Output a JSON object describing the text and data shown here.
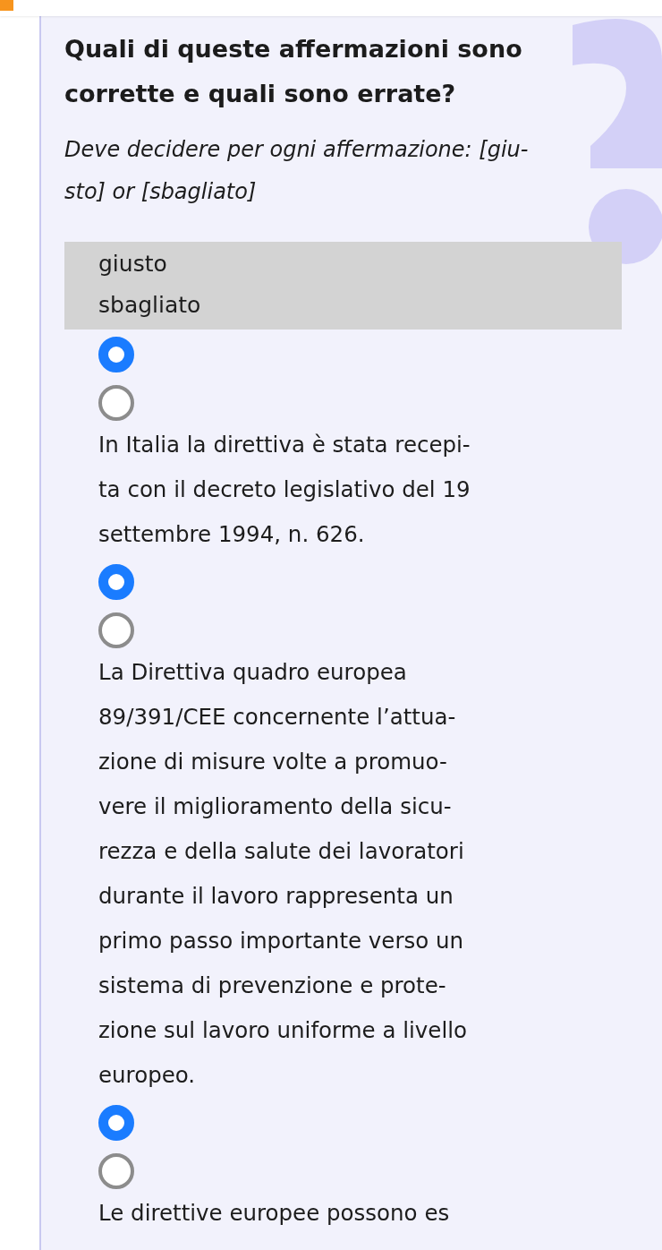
{
  "question": {
    "title": "Quali di queste affermazioni sono corrette e quali sono errate?",
    "instruction": [
      "Deve decidere per ogni affermazione: [giu-",
      "sto] or [sbagliato]"
    ]
  },
  "options": [
    "giusto",
    "sbagliato"
  ],
  "items": [
    {
      "kind": "radios",
      "radios": [
        {
          "selected": true
        },
        {
          "selected": false
        }
      ]
    },
    {
      "kind": "statement",
      "lines": [
        "In Italia la direttiva è stata recepi-",
        "ta con il decreto legislativo del 19",
        "settembre 1994, n. 626."
      ]
    },
    {
      "kind": "radios",
      "radios": [
        {
          "selected": true
        },
        {
          "selected": false
        }
      ]
    },
    {
      "kind": "statement",
      "lines": [
        "La Direttiva quadro europea",
        "89/391/CEE concernente l’attua-",
        "zione di misure volte a promuo-",
        "vere il miglioramento della sicu-",
        "rezza e della salute dei lavoratori",
        "durante il lavoro rappresenta un",
        "primo passo importante verso un",
        "sistema di prevenzione e prote-",
        "zione sul lavoro uniforme a livello",
        "europeo."
      ]
    },
    {
      "kind": "radios",
      "radios": [
        {
          "selected": true
        },
        {
          "selected": false
        }
      ]
    },
    {
      "kind": "statement",
      "lines": [
        "Le direttive europee possono es"
      ]
    }
  ]
}
